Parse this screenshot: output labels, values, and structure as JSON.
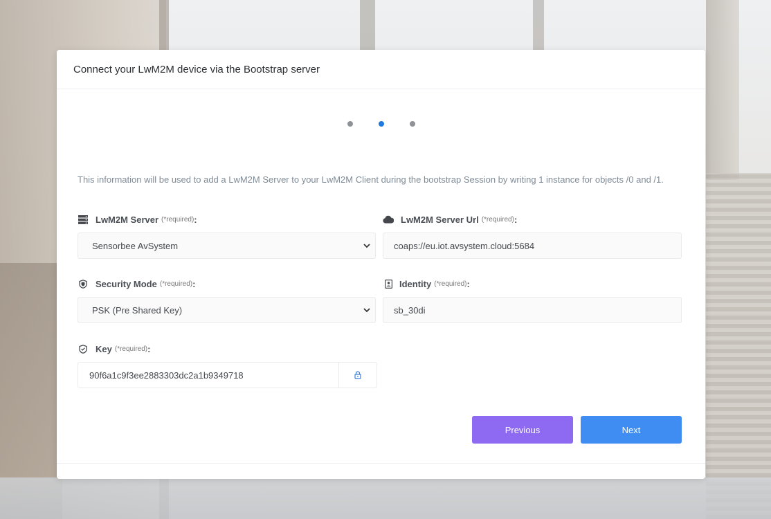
{
  "header": {
    "title": "Connect your LwM2M device via the Bootstrap server"
  },
  "steps": {
    "total": 3,
    "active_index": 1
  },
  "info_text": "This information will be used to add a LwM2M Server to your LwM2M Client during the bootstrap Session by writing 1 instance for objects /0 and /1.",
  "fields": {
    "server": {
      "label": "LwM2M Server",
      "required": "(*required)",
      "colon": ":",
      "value": "Sensorbee AvSystem",
      "icon": "server-icon"
    },
    "server_url": {
      "label": "LwM2M Server Url",
      "required": "(*required)",
      "colon": ":",
      "value": "coaps://eu.iot.avsystem.cloud:5684",
      "icon": "cloud-icon"
    },
    "security_mode": {
      "label": "Security Mode",
      "required": "(*required)",
      "colon": ":",
      "value": "PSK (Pre Shared Key)",
      "icon": "shield-icon"
    },
    "identity": {
      "label": "Identity",
      "required": "(*required)",
      "colon": ":",
      "value": "sb_30di",
      "icon": "id-card-icon"
    },
    "key": {
      "label": "Key",
      "required": "(*required)",
      "colon": ":",
      "value": "90f6a1c9f3ee2883303dc2a1b9349718",
      "icon": "shield-check-icon",
      "toggle_icon": "lock-icon"
    }
  },
  "buttons": {
    "previous": "Previous",
    "next": "Next"
  },
  "colors": {
    "active_step": "#1f7ae0",
    "previous_button": "#8e6af2",
    "next_button": "#3f8df2"
  }
}
